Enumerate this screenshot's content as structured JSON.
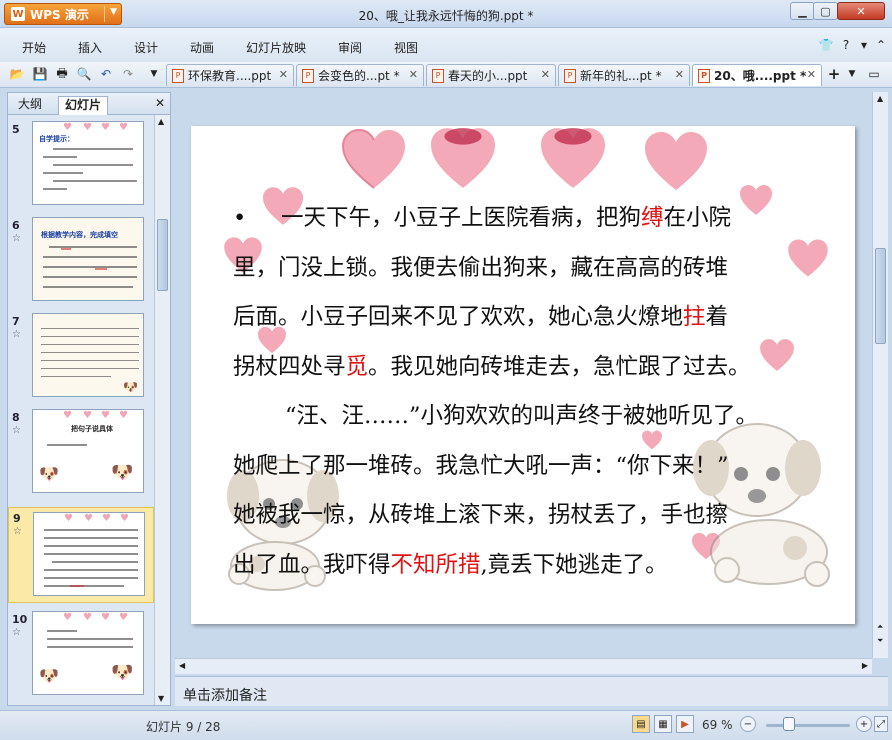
{
  "app": {
    "name": "WPS 演示",
    "window_title": "20、哦_让我永远忏悔的狗.ppt *"
  },
  "menu": [
    "开始",
    "插入",
    "设计",
    "动画",
    "幻灯片放映",
    "审阅",
    "视图"
  ],
  "doc_tabs": [
    {
      "label": "环保教育....ppt"
    },
    {
      "label": "会变色的...pt *"
    },
    {
      "label": "春天的小...ppt"
    },
    {
      "label": "新年的礼...pt *"
    },
    {
      "label": "20、哦....ppt *"
    }
  ],
  "left_panel": {
    "tab_outline": "大纲",
    "tab_slides": "幻灯片",
    "thumbnails": [
      {
        "num": "5",
        "star": "",
        "title": "自学提示："
      },
      {
        "num": "6",
        "star": "☆",
        "title": "根据教学内容，完成填空"
      },
      {
        "num": "7",
        "star": "☆",
        "title": ""
      },
      {
        "num": "8",
        "star": "☆",
        "title": "把句子说具体"
      },
      {
        "num": "9",
        "star": "☆",
        "title": ""
      },
      {
        "num": "10",
        "star": "☆",
        "title": ""
      }
    ]
  },
  "slide": {
    "lines": [
      [
        {
          "t": "一天下午，小豆子上医院看病，把狗",
          "r": false
        },
        {
          "t": "缚",
          "r": true
        },
        {
          "t": "在小院",
          "r": false
        }
      ],
      [
        {
          "t": "里，门没上锁。我便去偷出狗来，藏在高高的砖堆",
          "r": false
        }
      ],
      [
        {
          "t": "后面。小豆子回来不见了欢欢，她心急火燎地",
          "r": false
        },
        {
          "t": "拄",
          "r": true
        },
        {
          "t": "着",
          "r": false
        }
      ],
      [
        {
          "t": "拐杖四处寻",
          "r": false
        },
        {
          "t": "觅",
          "r": true
        },
        {
          "t": "。我见她向砖堆走去，急忙跟了过去。",
          "r": false
        }
      ],
      [
        {
          "t": "“汪、汪……”小狗欢欢的叫声终于被她听见了。",
          "r": false
        }
      ],
      [
        {
          "t": "她爬上了那一堆砖。我急忙大吼一声：“你下来！”",
          "r": false
        }
      ],
      [
        {
          "t": "她被我一惊，从砖堆上滚下来，拐杖丢了，手也擦",
          "r": false
        }
      ],
      [
        {
          "t": "出了血。我吓得",
          "r": false
        },
        {
          "t": "不知所措",
          "r": true
        },
        {
          "t": ",竟丢下她逃走了。",
          "r": false
        }
      ]
    ],
    "bullet": "•"
  },
  "notes_placeholder": "单击添加备注",
  "status": {
    "slide_counter": "幻灯片 9 / 28",
    "zoom": "69 %"
  },
  "colors": {
    "accent_red": "#e01212",
    "wps_orange": "#e0701a",
    "heart_pink": "#f4a9b8",
    "selected_thumb": "#fbe9a7"
  }
}
